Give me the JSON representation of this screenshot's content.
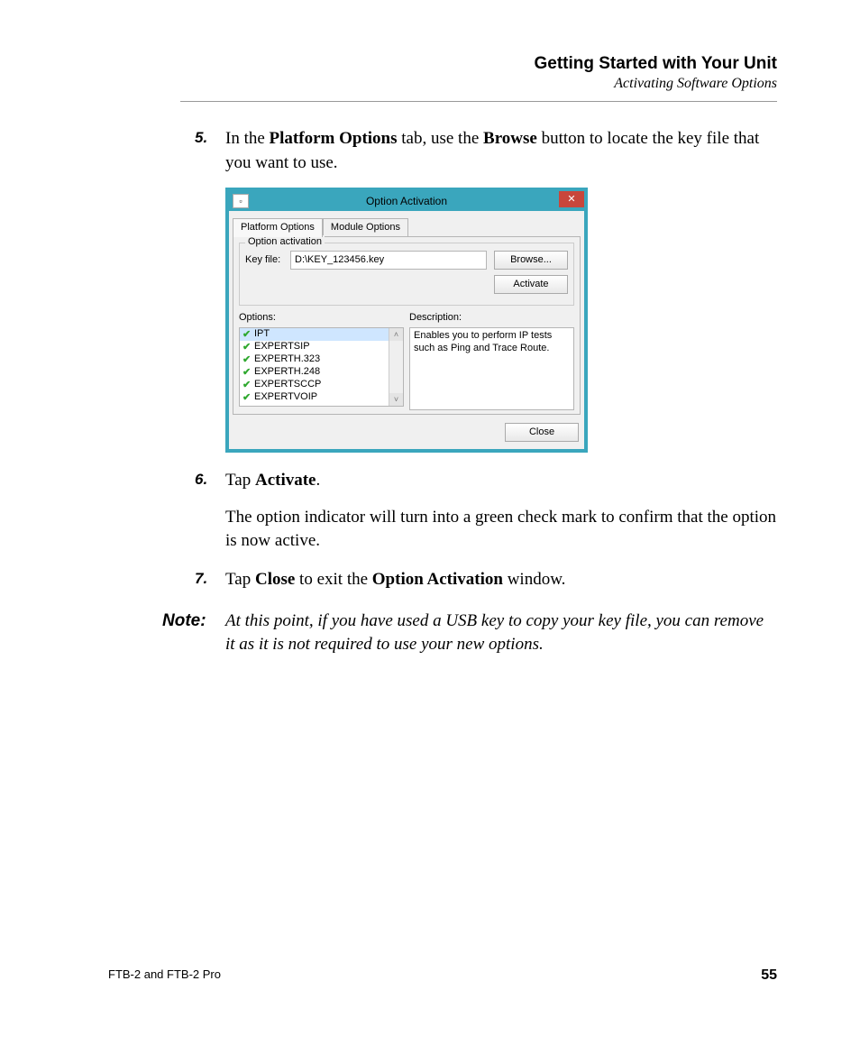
{
  "header": {
    "title": "Getting Started with Your Unit",
    "subtitle": "Activating Software Options"
  },
  "steps": {
    "s5": {
      "num": "5.",
      "text_a": "In the ",
      "bold_a": "Platform Options",
      "text_b": " tab, use the ",
      "bold_b": "Browse",
      "text_c": " button to locate the key file that you want to use."
    },
    "s6": {
      "num": "6.",
      "text_a": "Tap ",
      "bold_a": "Activate",
      "text_b": ".",
      "para2": "The option indicator will turn into a green check mark to confirm that the option is now active."
    },
    "s7": {
      "num": "7.",
      "text_a": "Tap ",
      "bold_a": "Close",
      "text_b": " to exit the ",
      "bold_b": "Option Activation",
      "text_c": " window."
    }
  },
  "note": {
    "label": "Note:",
    "text": "At this point, if you have used a USB key to copy your key file, you can remove it as it is not required to use your new options."
  },
  "footer": {
    "product": "FTB-2 and FTB-2 Pro",
    "page": "55"
  },
  "window": {
    "title": "Option Activation",
    "tabs": {
      "active": "Platform Options",
      "inactive": "Module Options"
    },
    "group_title": "Option activation",
    "keyfile_label": "Key file:",
    "keyfile_value": "D:\\KEY_123456.key",
    "browse_btn": "Browse...",
    "activate_btn": "Activate",
    "options_label": "Options:",
    "description_label": "Description:",
    "options_list": {
      "i0": "IPT",
      "i1": "EXPERTSIP",
      "i2": "EXPERTH.323",
      "i3": "EXPERTH.248",
      "i4": "EXPERTSCCP",
      "i5": "EXPERTVOIP"
    },
    "description_text": "Enables you to perform IP tests such as Ping and Trace Route.",
    "close_btn": "Close"
  }
}
